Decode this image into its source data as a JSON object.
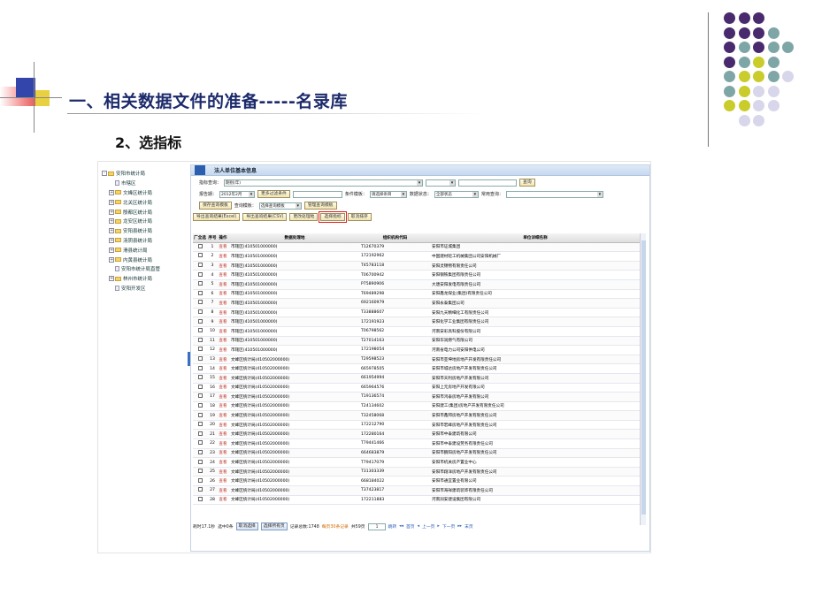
{
  "slide": {
    "title": "一、相关数据文件的准备-----名录库",
    "subtitle": "2、选指标"
  },
  "colors": {
    "title": "#1c2a6b",
    "dot_purple": "#4a2a6e",
    "dot_teal": "#7fa6a6",
    "dot_yellow": "#c9cc2a",
    "dot_lavender": "#d8d6ea"
  },
  "tree": [
    {
      "label": "安阳市统计局",
      "icon": "folder-icon",
      "expander": "-"
    },
    {
      "label": "市辖区",
      "icon": "page-icon",
      "expander": ""
    },
    {
      "label": "文峰区统计局",
      "icon": "folder-icon",
      "expander": "+"
    },
    {
      "label": "北关区统计局",
      "icon": "folder-icon",
      "expander": "+"
    },
    {
      "label": "殷都区统计局",
      "icon": "folder-icon",
      "expander": "+"
    },
    {
      "label": "龙安区统计局",
      "icon": "folder-icon",
      "expander": "+"
    },
    {
      "label": "安阳县统计局",
      "icon": "folder-icon",
      "expander": "+"
    },
    {
      "label": "汤阴县统计局",
      "icon": "folder-icon",
      "expander": "+"
    },
    {
      "label": "滑县统计局",
      "icon": "folder-icon",
      "expander": "+"
    },
    {
      "label": "内黄县统计局",
      "icon": "folder-icon",
      "expander": "+"
    },
    {
      "label": "安阳市统计局直管",
      "icon": "page-icon",
      "expander": ""
    },
    {
      "label": "林州市统计局",
      "icon": "folder-icon",
      "expander": "+"
    },
    {
      "label": "安阳开发区",
      "icon": "page-icon",
      "expander": ""
    }
  ],
  "panel": {
    "title": "法人单位基本信息",
    "indicator_label": "指标查询：",
    "indicator_value": "期别(年)",
    "query_button": "查询",
    "report_period_label": "报告期：",
    "report_period_value": "2012年2月",
    "more_filters_button": "更多过滤条件",
    "condition_template_label": "条件模板：",
    "condition_template_value": "请选择条目",
    "data_status_label": "数据状态：",
    "data_status_value": "全部状态",
    "common_query_label": "常用查询：",
    "save_template_button": "保存查询模板",
    "query_template_label": "查询模板：",
    "query_template_value": "选择查询模板",
    "manage_template_button": "管理查询模板",
    "export_excel_button": "导出查询结果(Excel)",
    "export_csv_button": "导出查询结果(CSV)",
    "change_process_button": "更改处理地",
    "select_indicator_button": "选择指标",
    "cancel_sort_button": "取消排序"
  },
  "table": {
    "headers": [
      "厂全选",
      "序号",
      "操作",
      "数据处理地",
      "组织机构代码",
      "单位详细名称"
    ],
    "action_label": "查看",
    "rows": [
      {
        "n": "1",
        "place": "市辖区(410501000000)",
        "code": "T12670379",
        "name": "安阳市证城集团"
      },
      {
        "n": "2",
        "place": "市辖区(410501000000)",
        "code": "172192962",
        "name": "中国建材轻工机械集团公司安阳机械厂"
      },
      {
        "n": "3",
        "place": "市辖区(410501000000)",
        "code": "T45783118",
        "name": "安阳灵锦物有限责任公司"
      },
      {
        "n": "4",
        "place": "市辖区(410501000000)",
        "code": "T06700942",
        "name": "安阳钢铁集团有限责任公司"
      },
      {
        "n": "5",
        "place": "市辖区(410501000000)",
        "code": "P75890906",
        "name": "大唐安阳发电有限责任公司"
      },
      {
        "n": "6",
        "place": "市辖区(410501000000)",
        "code": "T69489298",
        "name": "安阳鑫龙煤业(集团)有限责任公司"
      },
      {
        "n": "7",
        "place": "市辖区(410501000000)",
        "code": "692160979",
        "name": "安阳永泰集团公司"
      },
      {
        "n": "8",
        "place": "市辖区(410501000000)",
        "code": "T33888607",
        "name": "安阳九天精细化工有限责任公司"
      },
      {
        "n": "9",
        "place": "市辖区(410501000000)",
        "code": "172191923",
        "name": "安阳化学工业集团有限责任公司"
      },
      {
        "n": "10",
        "place": "市辖区(410501000000)",
        "code": "T06798562",
        "name": "河南安彩高科股份有限公司"
      },
      {
        "n": "11",
        "place": "市辖区(410501000000)",
        "code": "T27014163",
        "name": "安阳华润燃气有限公司"
      },
      {
        "n": "12",
        "place": "市辖区(410501000000)",
        "code": "172198054",
        "name": "河南省电力公司安阳供电公司"
      },
      {
        "n": "13",
        "place": "文峰区统计局(410502000000)",
        "code": "T29598523",
        "name": "安阳市亚坤地房地产开发有限责任公司"
      },
      {
        "n": "14",
        "place": "文峰区统计局(410502000000)",
        "code": "665978505",
        "name": "安阳市城达房地产开发有限责任公司"
      },
      {
        "n": "15",
        "place": "文峰区统计局(410502000000)",
        "code": "661954994",
        "name": "安阳市天利房地产开发有限公司"
      },
      {
        "n": "16",
        "place": "文峰区统计局(410502000000)",
        "code": "665964576",
        "name": "安阳上元房地产开发有限公司"
      },
      {
        "n": "17",
        "place": "文峰区统计局(410502000000)",
        "code": "T19136574",
        "name": "安阳市鸿泰房地产开发有限公司"
      },
      {
        "n": "18",
        "place": "文峰区统计局(410502000000)",
        "code": "T24134602",
        "name": "安阳建工(集团)房地产开发有限责任公司"
      },
      {
        "n": "19",
        "place": "文峰区统计局(410502000000)",
        "code": "T32458068",
        "name": "安阳市鑫邦房地产开发有限责任公司"
      },
      {
        "n": "20",
        "place": "文峰区统计局(410502000000)",
        "code": "172212790",
        "name": "安阳市宏峰房地产开发有限责任公司"
      },
      {
        "n": "21",
        "place": "文峰区统计局(410502000000)",
        "code": "172280164",
        "name": "安阳市中泰建筑有限公司"
      },
      {
        "n": "22",
        "place": "文峰区统计局(410502000000)",
        "code": "T79441466",
        "name": "安阳市中泰建设劳务有限责任公司"
      },
      {
        "n": "23",
        "place": "文峰区统计局(410502000000)",
        "code": "664683879",
        "name": "安阳市鹏阳房地产开发有限责任公司"
      },
      {
        "n": "24",
        "place": "文峰区统计局(410502000000)",
        "code": "T79417079",
        "name": "安阳市机关房产置业中心"
      },
      {
        "n": "25",
        "place": "文峰区统计局(410502000000)",
        "code": "T31303339",
        "name": "安阳市翔洋房地产开发有限责任公司"
      },
      {
        "n": "26",
        "place": "文峰区统计局(410502000000)",
        "code": "668184022",
        "name": "安阳市通宜置业有限公司"
      },
      {
        "n": "27",
        "place": "文峰区统计局(410502000000)",
        "code": "T37423817",
        "name": "安阳市海祥建筑装饰有限责任公司"
      },
      {
        "n": "28",
        "place": "文峰区统计局(410502000000)",
        "code": "172211883",
        "name": "河南润安建设集团有限公司"
      }
    ]
  },
  "pager": {
    "elapsed": "耗时17.1秒",
    "selected": "选中0条",
    "cancel_select_button": "取消选择",
    "select_all_button": "选择所有页",
    "total": "记录总数:1748",
    "per_page": "每页30条记录",
    "pages": "共59页",
    "page_value": "1",
    "jump": "跳转",
    "first": "首页",
    "prev": "上一页",
    "next": "下一页",
    "last": "末页"
  }
}
